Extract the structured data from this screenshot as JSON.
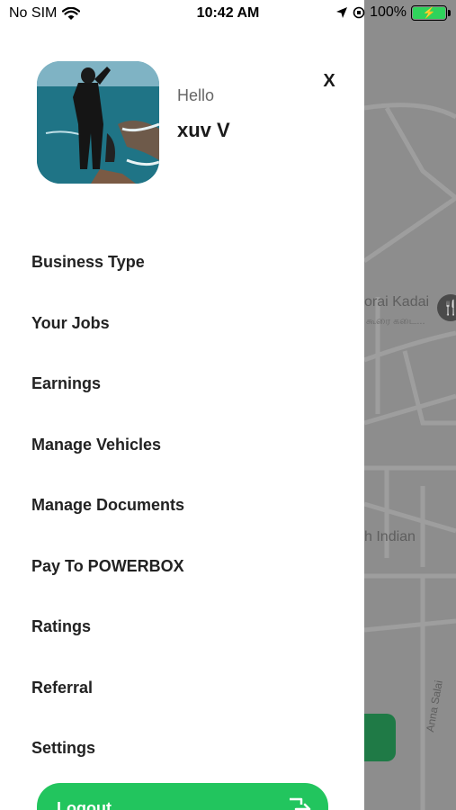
{
  "status_bar": {
    "carrier": "No SIM",
    "time": "10:42 AM",
    "battery_percent": "100%"
  },
  "profile": {
    "greeting": "Hello",
    "name": "xuv V"
  },
  "close_label": "X",
  "menu": {
    "items": [
      {
        "label": "Business Type"
      },
      {
        "label": "Your Jobs"
      },
      {
        "label": "Earnings"
      },
      {
        "label": "Manage Vehicles"
      },
      {
        "label": "Manage Documents"
      },
      {
        "label": "Pay To POWERBOX"
      },
      {
        "label": "Ratings"
      },
      {
        "label": "Referral"
      },
      {
        "label": "Settings"
      }
    ]
  },
  "logout": {
    "label": "Logout"
  },
  "map": {
    "label_1": "orai Kadai",
    "label_1_sub": "கூரை கடை...",
    "label_2": "h Indian",
    "road": "Anna Salai"
  },
  "colors": {
    "accent": "#22c55e",
    "battery": "#2fd35b"
  }
}
